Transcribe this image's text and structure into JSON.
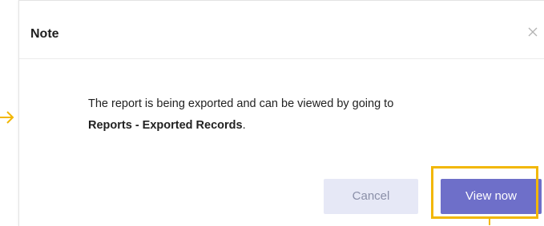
{
  "dialog": {
    "title": "Note",
    "message_prefix": "The report is being exported and can be viewed by going to",
    "message_link": "Reports - Exported Records",
    "message_suffix": ".",
    "cancel_label": "Cancel",
    "confirm_label": "View now"
  },
  "colors": {
    "primary": "#6e6fc9",
    "cancel_bg": "#e6e8f6",
    "highlight": "#f2b705"
  },
  "icons": {
    "close": "close-icon",
    "pointer": "arrow-right-icon"
  }
}
